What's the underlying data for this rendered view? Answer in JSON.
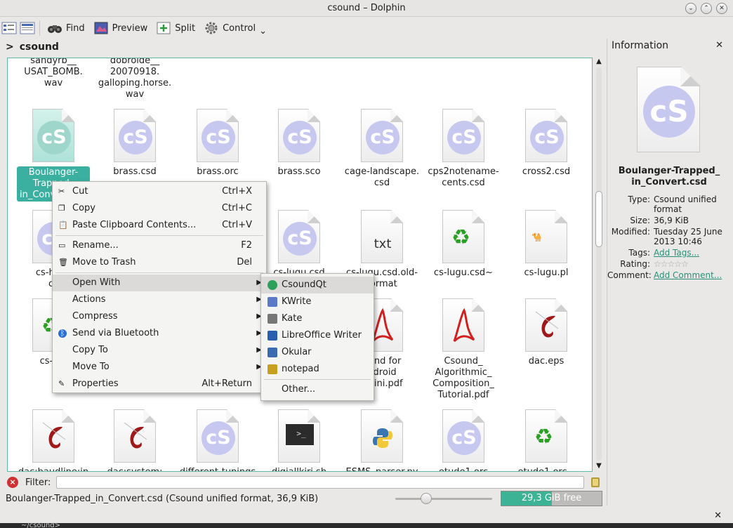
{
  "window": {
    "title": "csound – Dolphin",
    "btn_min": "⌄",
    "btn_max": "⌃",
    "btn_close": "✕"
  },
  "toolbar": {
    "find": "Find",
    "preview": "Preview",
    "split": "Split",
    "control": "Control",
    "control_arrow": "⌄"
  },
  "breadcrumb": {
    "chevron": ">",
    "folder": "csound"
  },
  "files": {
    "row0": [
      {
        "name": "sandyrb__\nUSAT_BOMB.\nwav"
      },
      {
        "name": "dobroide__\n20070918.\ngalloping.horse.\nwav"
      }
    ],
    "row1": [
      {
        "name": "Boulanger-\nTrapped_\nin_Convert.csd",
        "icon": "csound-icon",
        "selected": true
      },
      {
        "name": "brass.csd",
        "icon": "csound-icon"
      },
      {
        "name": "brass.orc",
        "icon": "csound-icon"
      },
      {
        "name": "brass.sco",
        "icon": "csound-icon"
      },
      {
        "name": "cage-landscape.\ncsd",
        "icon": "csound-icon"
      },
      {
        "name": "cps2notename-\ncents.csd",
        "icon": "csound-icon"
      },
      {
        "name": "cross2.csd",
        "icon": "csound-icon"
      }
    ],
    "row2": [
      {
        "name": "cs-helih\ncs",
        "icon": "csound-icon"
      },
      {
        "name": "",
        "icon": "csound-icon"
      },
      {
        "name": "",
        "icon": "csound-icon"
      },
      {
        "name": "cs-lugu.csd",
        "icon": "csound-icon"
      },
      {
        "name": "cs-lugu.csd.old-\nformat",
        "icon": "text-icon",
        "icon_text": "txt"
      },
      {
        "name": "cs-lugu.csd~",
        "icon": "recycle-icon"
      },
      {
        "name": "cs-lugu.pl",
        "icon": "camel-icon"
      }
    ],
    "row3": [
      {
        "name": "cs-lug",
        "icon": "recycle-icon"
      },
      {
        "name": "",
        "icon": "csound-icon"
      },
      {
        "name": "",
        "icon": "csound-icon"
      },
      {
        "name": "",
        "icon": "csound-icon"
      },
      {
        "name": "ound for\nndroid\ntarini.pdf",
        "icon": "pdf-icon"
      },
      {
        "name": "Csound_\nAlgorithmic_\nComposition_\nTutorial.pdf",
        "icon": "pdf-icon"
      },
      {
        "name": "dac.eps",
        "icon": "vector-icon"
      }
    ],
    "row4": [
      {
        "name": "dac:haudline:in",
        "icon": "vector-icon"
      },
      {
        "name": "dac:system:",
        "icon": "vector-icon"
      },
      {
        "name": "different-tunings",
        "icon": "csound-icon"
      },
      {
        "name": "digiallkiri.sh",
        "icon": "terminal-icon"
      },
      {
        "name": "ESMS_parser.py",
        "icon": "python-icon"
      },
      {
        "name": "etude1.orc",
        "icon": "csound-icon"
      },
      {
        "name": "etude1.orc~",
        "icon": "recycle-icon"
      }
    ],
    "cs_glyph": "cS"
  },
  "context_menu": [
    {
      "label": "Cut",
      "shortcut": "Ctrl+X",
      "icon": "scissors-icon"
    },
    {
      "label": "Copy",
      "shortcut": "Ctrl+C",
      "icon": "copy-icon"
    },
    {
      "label": "Paste Clipboard Contents...",
      "shortcut": "Ctrl+V",
      "icon": "paste-icon"
    },
    {
      "label": "Rename...",
      "shortcut": "F2",
      "icon": "rename-icon"
    },
    {
      "label": "Move to Trash",
      "shortcut": "Del",
      "icon": "trash-icon"
    },
    {
      "label": "Open With",
      "submenu": true,
      "highlighted": true
    },
    {
      "label": "Actions",
      "submenu": true
    },
    {
      "label": "Compress",
      "submenu": true
    },
    {
      "label": "Send via Bluetooth",
      "submenu": true,
      "icon": "bluetooth-icon"
    },
    {
      "label": "Copy To",
      "submenu": true
    },
    {
      "label": "Move To",
      "submenu": true
    },
    {
      "label": "Properties",
      "shortcut": "Alt+Return",
      "icon": "properties-icon"
    }
  ],
  "open_with_menu": [
    "CsoundQt",
    "KWrite",
    "Kate",
    "LibreOffice Writer",
    "Okular",
    "notepad",
    "Other..."
  ],
  "filter": {
    "label": "Filter:",
    "value": ""
  },
  "status": {
    "text": "Boulanger-Trapped_in_Convert.csd (Csound unified format, 36,9 KiB)",
    "zoom_level": 0.3,
    "free_space": "29,3 GiB free",
    "used_fraction": 0.5
  },
  "info_panel": {
    "title": "Information",
    "close": "✕",
    "filename": "Boulanger-Trapped_\nin_Convert.csd",
    "rows": [
      {
        "key": "Type:",
        "value": "Csound unified format"
      },
      {
        "key": "Size:",
        "value": "36,9 KiB"
      },
      {
        "key": "Modified:",
        "value": "Tuesday 25 June 2013 10:46"
      },
      {
        "key": "Tags:",
        "value": "Add Tags...",
        "link": true
      },
      {
        "key": "Rating:",
        "value": "",
        "stars": 0
      },
      {
        "key": "Comment:",
        "value": "Add Comment...",
        "link": true
      }
    ]
  },
  "terminal": {
    "close": "✕",
    "prompt": "~/csound>"
  }
}
